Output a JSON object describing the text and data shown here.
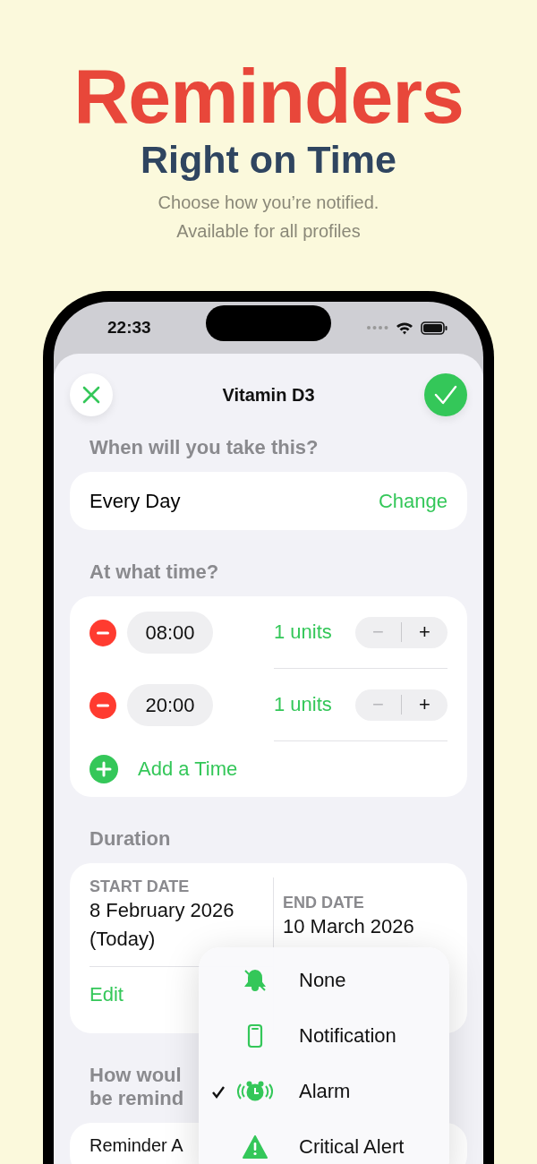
{
  "hero": {
    "title": "Reminders",
    "subtitle": "Right on Time",
    "description_lines": [
      "Choose how you’re notified.",
      "Available for all profiles"
    ]
  },
  "status_bar": {
    "time": "22:33"
  },
  "sheet": {
    "title": "Vitamin D3",
    "schedule": {
      "heading": "When will you take this?",
      "value": "Every Day",
      "action": "Change"
    },
    "times": {
      "heading": "At what time?",
      "add_label": "Add a Time",
      "entries": [
        {
          "time": "08:00",
          "dose": "1 units",
          "decrement": "−",
          "increment": "+",
          "decrement_disabled": true
        },
        {
          "time": "20:00",
          "dose": "1 units",
          "decrement": "−",
          "increment": "+",
          "decrement_disabled": true
        }
      ]
    },
    "duration": {
      "heading": "Duration",
      "start_label": "START DATE",
      "start_value": "8 February 2026 (Today)",
      "edit": "Edit",
      "end_label": "END DATE",
      "end_value": "10 March 2026"
    },
    "reminder": {
      "heading_lines": [
        "How woul",
        "be remind"
      ],
      "field_label": "Reminder A"
    }
  },
  "reminder_menu": [
    {
      "label": "None",
      "kind": "none",
      "selected": false
    },
    {
      "label": "Notification",
      "kind": "notification",
      "selected": false
    },
    {
      "label": "Alarm",
      "kind": "alarm",
      "selected": true
    },
    {
      "label": "Critical Alert",
      "kind": "critical",
      "selected": false
    }
  ]
}
